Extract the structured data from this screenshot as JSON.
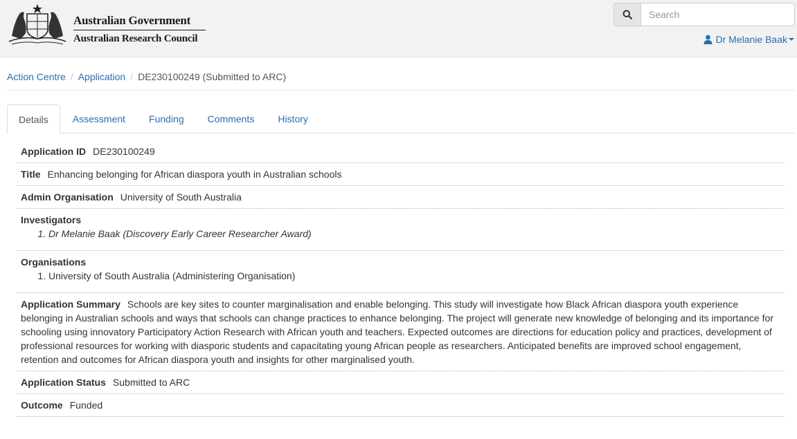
{
  "header": {
    "gov_name": "Australian Government",
    "council_name": "Australian Research Council",
    "crest_icon": "coat-of-arms-icon"
  },
  "search": {
    "placeholder": "Search",
    "icon": "search-icon"
  },
  "user": {
    "name": "Dr Melanie Baak",
    "icon": "user-icon"
  },
  "breadcrumb": {
    "items": [
      "Action Centre",
      "Application"
    ],
    "current": "DE230100249 (Submitted to ARC)"
  },
  "tabs": [
    {
      "label": "Details",
      "active": true
    },
    {
      "label": "Assessment",
      "active": false
    },
    {
      "label": "Funding",
      "active": false
    },
    {
      "label": "Comments",
      "active": false
    },
    {
      "label": "History",
      "active": false
    }
  ],
  "details": {
    "application_id": {
      "label": "Application ID",
      "value": "DE230100249"
    },
    "title": {
      "label": "Title",
      "value": "Enhancing belonging for African diaspora youth in Australian schools"
    },
    "admin_org": {
      "label": "Admin Organisation",
      "value": "University of South Australia"
    },
    "investigators": {
      "label": "Investigators",
      "items": [
        "Dr Melanie Baak (Discovery Early Career Researcher Award)"
      ]
    },
    "organisations": {
      "label": "Organisations",
      "items": [
        "University of South Australia (Administering Organisation)"
      ]
    },
    "summary": {
      "label": "Application Summary",
      "value": "Schools are key sites to counter marginalisation and enable belonging. This study will investigate how Black African diaspora youth experience belonging in Australian schools and ways that schools can change practices to enhance belonging. The project will generate new knowledge of belonging and its importance for schooling using innovatory Participatory Action Research with African youth and teachers. Expected outcomes are directions for education policy and practices, development of professional resources for working with diasporic students and capacitating young African people as researchers. Anticipated benefits are improved school engagement, retention and outcomes for African diaspora youth and insights for other marginalised youth."
    },
    "status": {
      "label": "Application Status",
      "value": "Submitted to ARC"
    },
    "outcome": {
      "label": "Outcome",
      "value": "Funded"
    }
  },
  "colors": {
    "link": "#2a6ead",
    "header_bg": "#f2f2f2"
  }
}
